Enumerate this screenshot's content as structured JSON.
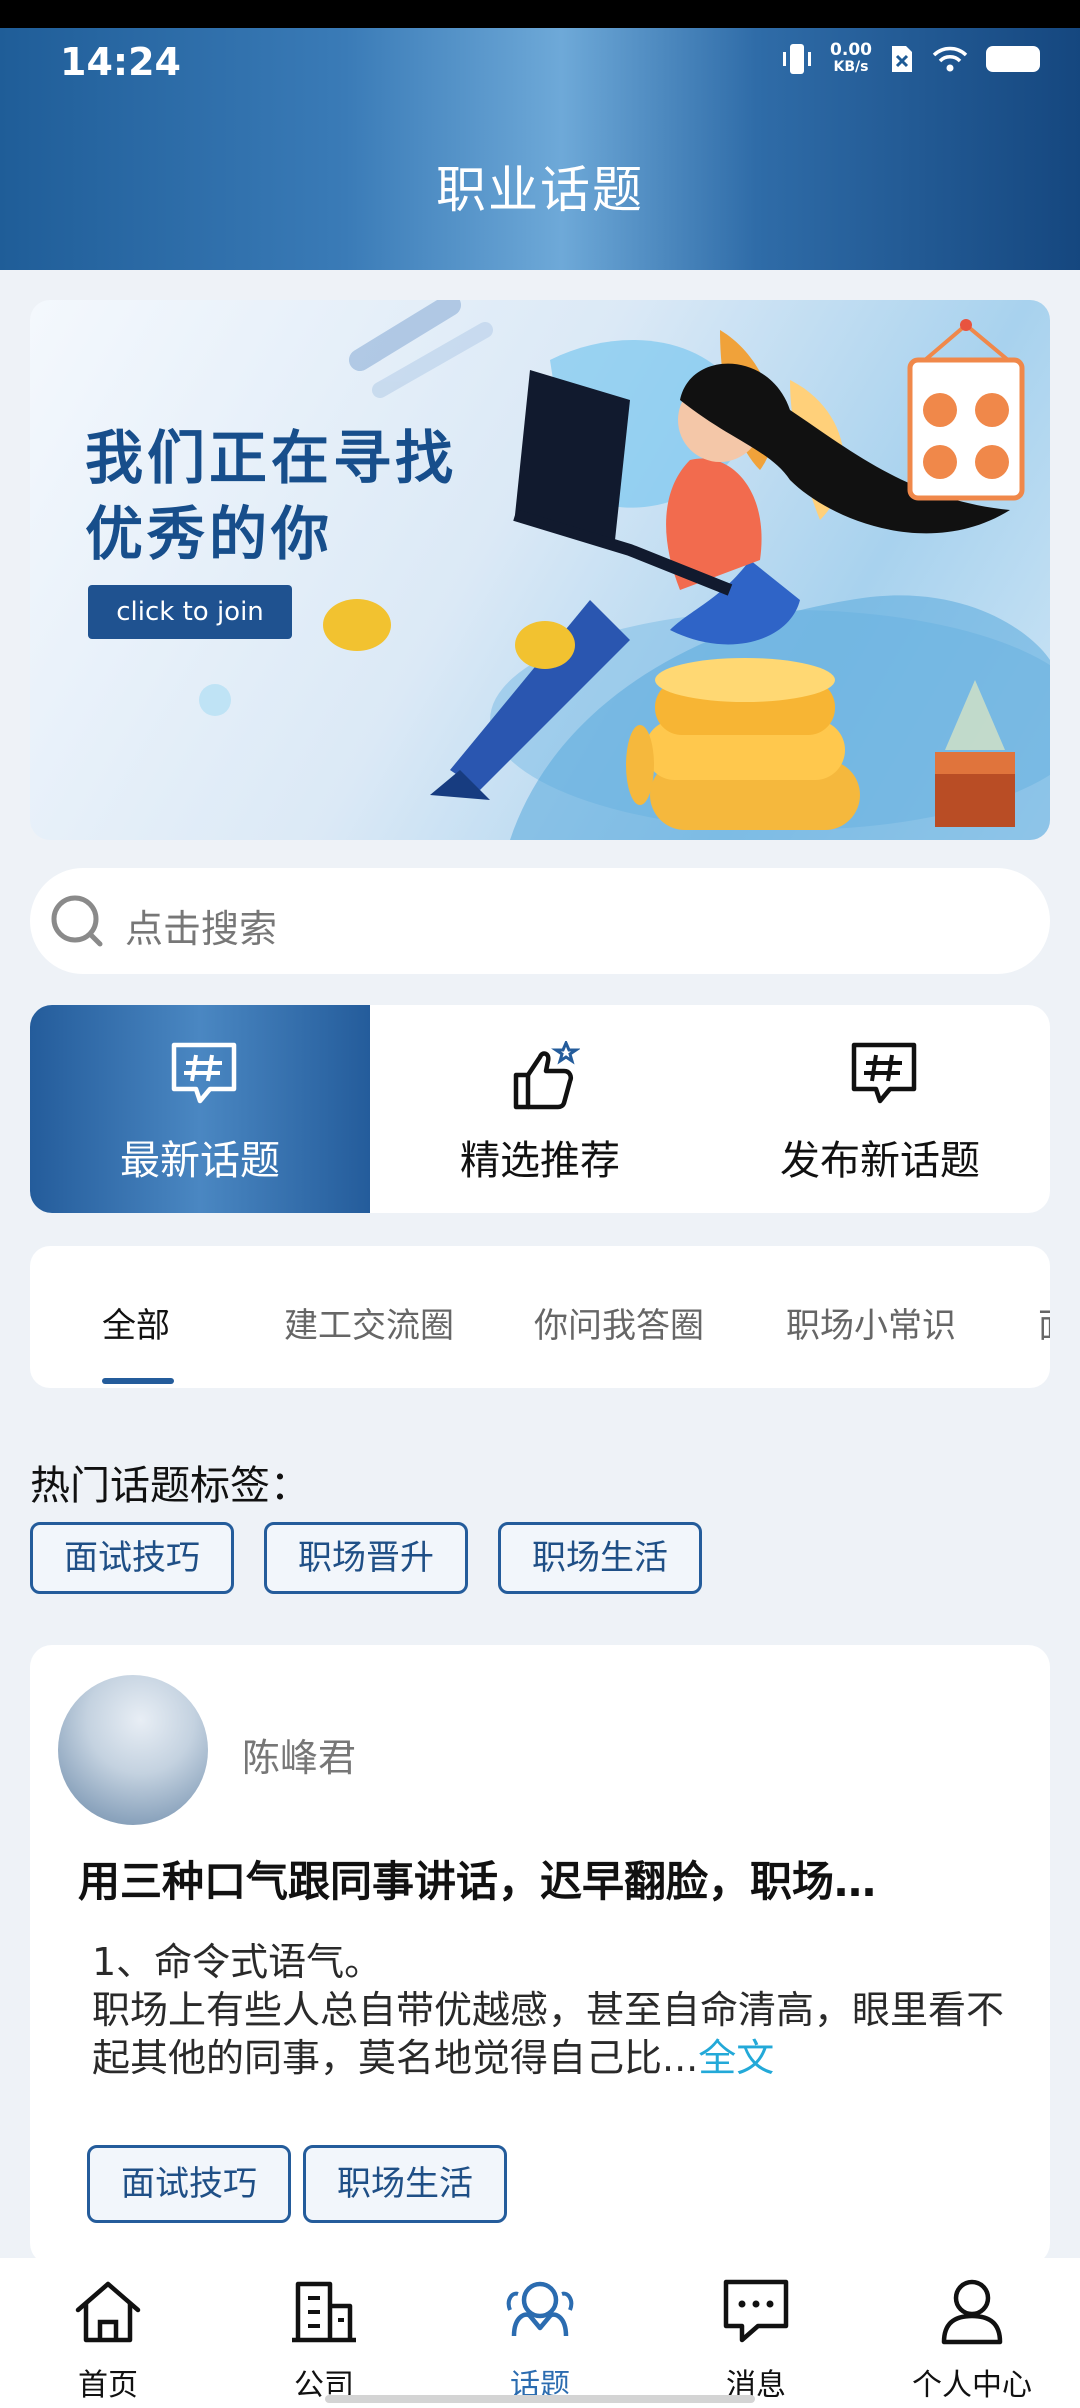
{
  "status": {
    "time": "14:24",
    "net_speed": "0.00",
    "net_unit": "KB/s"
  },
  "header": {
    "title": "职业话题"
  },
  "banner": {
    "line1": "我们正在寻找",
    "line2": "优秀的你",
    "cta": "click to join"
  },
  "search": {
    "placeholder": "点击搜索"
  },
  "quick_actions": [
    {
      "label": "最新话题",
      "icon": "hash-chat-icon"
    },
    {
      "label": "精选推荐",
      "icon": "thumbs-up-icon"
    },
    {
      "label": "发布新话题",
      "icon": "hash-chat-icon"
    }
  ],
  "tabs": [
    "全部",
    "建工交流圈",
    "你问我答圈",
    "职场小常识",
    "面"
  ],
  "hot": {
    "title": "热门话题标签：",
    "tags": [
      "面试技巧",
      "职场晋升",
      "职场生活"
    ]
  },
  "post": {
    "author": "陈峰君",
    "title": "用三种口气跟同事讲话，迟早翻脸，职场…",
    "body_line1": "1、命令式语气。",
    "body_line2": "职场上有些人总自带优越感，甚至自命清高，眼里看不起其他的同事，莫名地觉得自己比...",
    "more": "全文",
    "tags": [
      "面试技巧",
      "职场生活"
    ]
  },
  "nav": [
    {
      "label": "首页",
      "icon": "home-icon"
    },
    {
      "label": "公司",
      "icon": "building-icon"
    },
    {
      "label": "话题",
      "icon": "topic-icon"
    },
    {
      "label": "消息",
      "icon": "message-icon"
    },
    {
      "label": "个人中心",
      "icon": "user-icon"
    }
  ],
  "colors": {
    "primary": "#245c9b",
    "accent_link": "#23a9d8",
    "background": "#eef2f7"
  }
}
